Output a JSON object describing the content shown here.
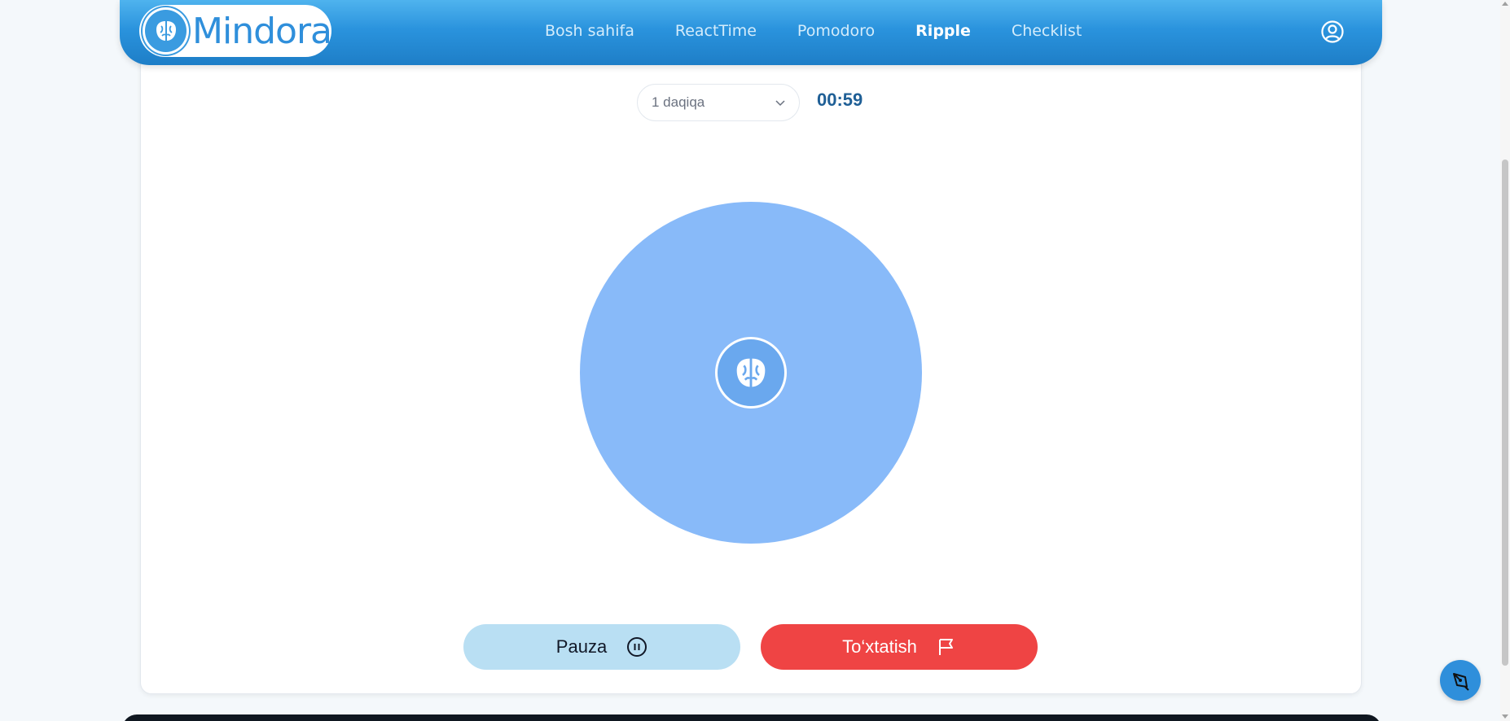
{
  "header": {
    "logo_text": "Mindora",
    "nav": [
      {
        "label": "Bosh sahifa",
        "active": false
      },
      {
        "label": "ReactTime",
        "active": false
      },
      {
        "label": "Pomodoro",
        "active": false
      },
      {
        "label": "Ripple",
        "active": true
      },
      {
        "label": "Checklist",
        "active": false
      }
    ],
    "user_icon": "user-circle-icon"
  },
  "controls": {
    "duration_value": "1 daqiqa",
    "timer": "00:59"
  },
  "ripple": {
    "color": "#88baf9",
    "center_icon": "brain-logo-icon"
  },
  "buttons": {
    "pause_label": "Pauza",
    "pause_icon": "pause-circle-icon",
    "stop_label": "To‘xtatish",
    "stop_icon": "flag-icon"
  },
  "colors": {
    "brand": "#2f8fdb",
    "stop": "#ef4444",
    "pause_bg": "#b9dff3",
    "timer": "#1f5f96"
  }
}
